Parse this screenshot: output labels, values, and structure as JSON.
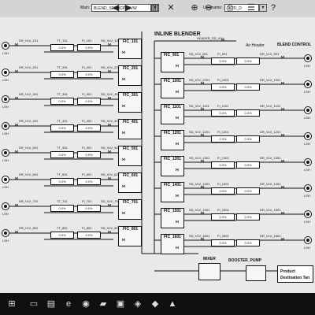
{
  "header": {
    "main_label": "Main:",
    "main_value": "BLEND_SELOOP_OVW",
    "username_label": "Username:",
    "username_value": "7IOTI_D"
  },
  "title": "INLINE BLENDER",
  "header_valve": "HEADER_SD_VLV",
  "air_header": "Air Header",
  "blend_control": "BLEND CONTROL",
  "motor_label": "LSH",
  "left_rows": [
    {
      "dr": "DR_VLV_101",
      "tt": "TT_101",
      "fi": "FI_101",
      "sd": "SD_VLV_101",
      "fic": "FIC_101",
      "v1": "0.0%",
      "v2": "0.0%"
    },
    {
      "dr": "DR_VLV_201",
      "tt": "TT_201",
      "fi": "FI_201",
      "sd": "SD_VLV_201",
      "fic": "FIC_201",
      "v1": "0.0%",
      "v2": "0.0%"
    },
    {
      "dr": "DR_VLV_301",
      "tt": "TT_301",
      "fi": "FI_301",
      "sd": "SD_VLV_301",
      "fic": "FIC_301",
      "v1": "0.0%",
      "v2": "0.0%"
    },
    {
      "dr": "DR_VLV_401",
      "tt": "TT_401",
      "fi": "FI_401",
      "sd": "SD_VLV_401",
      "fic": "FIC_401",
      "v1": "0.0%",
      "v2": "0.0%"
    },
    {
      "dr": "DR_VLV_501",
      "tt": "TT_501",
      "fi": "FI_501",
      "sd": "SD_VLV_501",
      "fic": "FIC_501",
      "v1": "0.0%",
      "v2": "0.0%"
    },
    {
      "dr": "DR_VLV_601",
      "tt": "TT_601",
      "fi": "FI_601",
      "sd": "SD_VLV_601",
      "fic": "FIC_601",
      "v1": "0.0%",
      "v2": "0.0%"
    },
    {
      "dr": "DR_VLV_701",
      "tt": "TT_701",
      "fi": "FI_701",
      "sd": "SD_VLV_701",
      "fic": "FIC_701",
      "v1": "0.0%",
      "v2": "0.0%"
    },
    {
      "dr": "DR_VLV_801",
      "tt": "TT_801",
      "fi": "FI_801",
      "sd": "SD_VLV_801",
      "fic": "FIC_801",
      "v1": "0.0%",
      "v2": "0.0%"
    }
  ],
  "right_rows": [
    {
      "dr": "DR_VLV_901",
      "fi": "FI_901",
      "sd": "SD_VLV_901",
      "fic": "FIC_901",
      "v1": "0.0%",
      "v2": "0.0%"
    },
    {
      "dr": "DR_VLV_1001",
      "fi": "FI_1001",
      "sd": "SD_VLV_1001",
      "fic": "FIC_1001",
      "v1": "0.0%",
      "v2": "0.0%"
    },
    {
      "dr": "DR_VLV_1101",
      "fi": "FI_1101",
      "sd": "SD_VLV_1101",
      "fic": "FIC_1101",
      "v1": "0.0%",
      "v2": "0.0%"
    },
    {
      "dr": "DR_VLV_1201",
      "fi": "FI_1201",
      "sd": "SD_VLV_1201",
      "fic": "FIC_1201",
      "v1": "0.0%",
      "v2": "0.0%"
    },
    {
      "dr": "DR_VLV_1301",
      "fi": "FI_1301",
      "sd": "SD_VLV_1301",
      "fic": "FIC_1301",
      "v1": "0.0%",
      "v2": "0.0%"
    },
    {
      "dr": "DR_VLV_1401",
      "fi": "FI_1401",
      "sd": "SD_VLV_1401",
      "fic": "FIC_1401",
      "v1": "0.0%",
      "v2": "0.0%"
    },
    {
      "dr": "DR_VLV_1501",
      "fi": "FI_1501",
      "sd": "SD_VLV_1501",
      "fic": "FIC_1501",
      "v1": "0.0%",
      "v2": "0.0%"
    },
    {
      "dr": "DR_VLV_1601",
      "fi": "FI_1601",
      "sd": "SD_VLV_1601",
      "fic": "FIC_1601",
      "v1": "0.0%",
      "v2": "0.0%"
    }
  ],
  "mixer_label": "MIXER",
  "booster_label": "BOOSTER_PUMP",
  "product_label": "Product",
  "destination_label": "Destination Tan",
  "toolbar_icons": [
    "back-icon",
    "forward-icon",
    "chart-icon",
    "tools-icon",
    "zoom-in-icon",
    "zoom-out-icon",
    "printer-icon",
    "list-icon",
    "help-icon"
  ],
  "taskbar_icons": [
    "windows-start-icon",
    "task-view-icon",
    "file-explorer-icon",
    "edge-icon",
    "chrome-icon",
    "folder-icon",
    "app-icon",
    "app2-icon",
    "app3-icon",
    "app4-icon"
  ]
}
